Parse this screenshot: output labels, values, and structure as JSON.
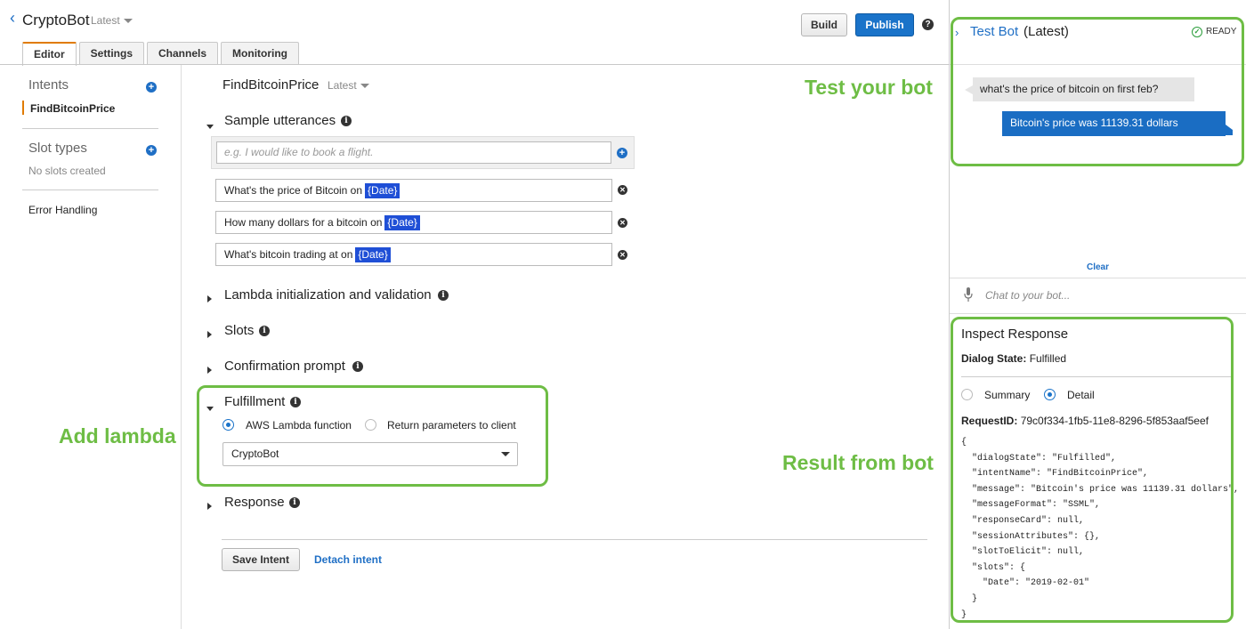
{
  "header": {
    "bot_name": "CryptoBot",
    "version": "Latest",
    "build_label": "Build",
    "publish_label": "Publish",
    "help_icon_glyph": "?"
  },
  "tabs": [
    "Editor",
    "Settings",
    "Channels",
    "Monitoring"
  ],
  "sidebar": {
    "intents_label": "Intents",
    "intent_item": "FindBitcoinPrice",
    "slot_types_label": "Slot types",
    "no_slots_text": "No slots created",
    "error_handling": "Error Handling"
  },
  "main": {
    "intent_name": "FindBitcoinPrice",
    "intent_version": "Latest",
    "sample_utterances_label": "Sample utterances",
    "utterance_placeholder": "e.g. I would like to book a flight.",
    "utterances": [
      {
        "text": "What's the price of Bitcoin on",
        "slot": "{Date}"
      },
      {
        "text": "How many dollars for a bitcoin on",
        "slot": "{Date}"
      },
      {
        "text": "What's bitcoin trading at on",
        "slot": "{Date}"
      }
    ],
    "lambda_label": "Lambda initialization and validation",
    "slots_label": "Slots",
    "confirmation_label": "Confirmation prompt",
    "fulfillment_label": "Fulfillment",
    "fulfillment_option_lambda": "AWS Lambda function",
    "fulfillment_option_return": "Return parameters to client",
    "lambda_selected": "CryptoBot",
    "response_label": "Response",
    "save_label": "Save Intent",
    "detach_label": "Detach intent"
  },
  "annotations": {
    "add_lambda": "Add lambda",
    "test_your_bot": "Test your bot",
    "result_from_bot": "Result from bot",
    "color": "#6ebd45"
  },
  "test_panel": {
    "title": "Test Bot",
    "version": "(Latest)",
    "status": "READY",
    "user_message": "what's the price of bitcoin on first feb?",
    "bot_message": "Bitcoin's price was 11139.31 dollars",
    "clear_label": "Clear",
    "chat_placeholder": "Chat to your bot..."
  },
  "inspect": {
    "title": "Inspect Response",
    "dialog_state_label": "Dialog State:",
    "dialog_state_value": "Fulfilled",
    "summary_label": "Summary",
    "detail_label": "Detail",
    "request_id_label": "RequestID:",
    "request_id_value": "79c0f334-1fb5-11e8-8296-5f853aaf5eef",
    "json_text": "{\n  \"dialogState\": \"Fulfilled\",\n  \"intentName\": \"FindBitcoinPrice\",\n  \"message\": \"Bitcoin's price was 11139.31 dollars\",\n  \"messageFormat\": \"SSML\",\n  \"responseCard\": null,\n  \"sessionAttributes\": {},\n  \"slotToElicit\": null,\n  \"slots\": {\n    \"Date\": \"2019-02-01\"\n  }\n}"
  }
}
